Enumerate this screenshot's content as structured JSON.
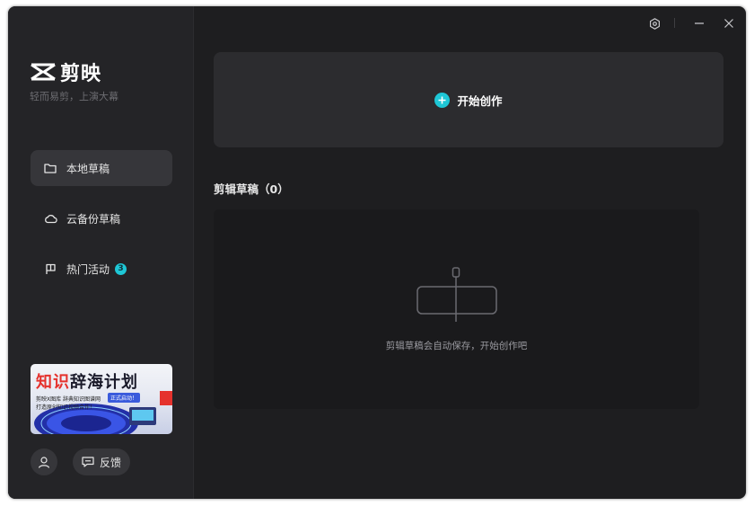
{
  "app": {
    "name": "剪映",
    "slogan": "轻而易剪，上演大幕"
  },
  "sidebar": {
    "items": [
      {
        "label": "本地草稿",
        "icon": "folder-icon",
        "active": true
      },
      {
        "label": "云备份草稿",
        "icon": "cloud-icon",
        "active": false
      },
      {
        "label": "热门活动",
        "icon": "flag-icon",
        "active": false,
        "badge": "3"
      }
    ],
    "banner": {
      "title_red": "知识",
      "title_rest": "辞海计划",
      "line1": "剪映X图库 辞典知识图谱网",
      "tag": "正式启动！",
      "line2": "打造原创知识视频合作！"
    },
    "feedback_label": "反馈"
  },
  "titlebar": {
    "settings_icon": "settings-icon",
    "minimize_icon": "minimize-icon",
    "close_icon": "close-icon"
  },
  "main": {
    "create_label": "开始创作",
    "drafts_title": "剪辑草稿（0）",
    "empty_text": "剪辑草稿会自动保存，开始创作吧"
  },
  "colors": {
    "accent": "#1ec7d6",
    "background": "#1e1e20",
    "sidebar": "#242427",
    "card": "#2c2c2f"
  }
}
